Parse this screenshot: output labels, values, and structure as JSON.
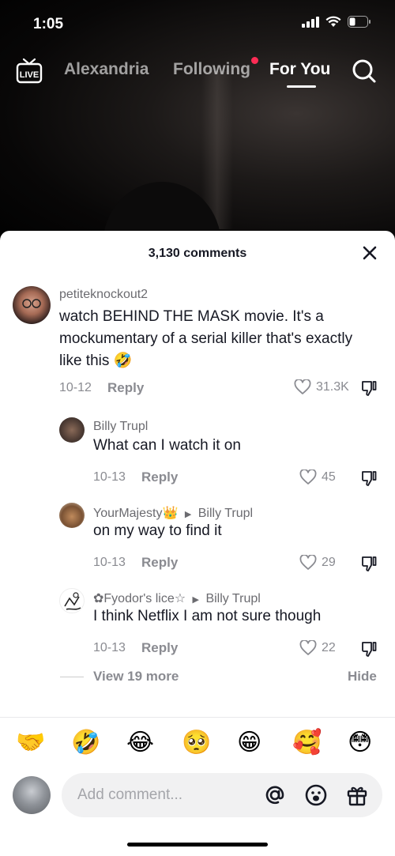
{
  "status_bar": {
    "time": "1:05"
  },
  "top_nav": {
    "live_label": "LIVE",
    "tabs": [
      {
        "label": "Alexandria",
        "active": false
      },
      {
        "label": "Following",
        "active": false,
        "has_dot": true
      },
      {
        "label": "For You",
        "active": true
      }
    ]
  },
  "comments_sheet": {
    "title": "3,130 comments",
    "comments": [
      {
        "username": "petiteknockout2",
        "text": "watch BEHIND THE MASK movie. It's a mockumentary of a serial killer that's exactly like this 🤣",
        "date": "10-12",
        "reply_label": "Reply",
        "likes": "31.3K"
      }
    ],
    "replies": [
      {
        "username": "Billy Trupl",
        "reply_to": "",
        "text": "What can I watch it on",
        "date": "10-13",
        "reply_label": "Reply",
        "likes": "45"
      },
      {
        "username": "YourMajesty👑",
        "reply_to": "Billy Trupl",
        "text": "on my way to find it",
        "date": "10-13",
        "reply_label": "Reply",
        "likes": "29"
      },
      {
        "username": "✿Fyodor's lice☆",
        "reply_to": "Billy Trupl",
        "text": "I think Netflix I am not sure though",
        "date": "10-13",
        "reply_label": "Reply",
        "likes": "22"
      }
    ],
    "view_more": "View 19 more",
    "hide": "Hide"
  },
  "emoji_bar": [
    "🤝",
    "🤣",
    "😂",
    "🥺",
    "😁",
    "🥰",
    "😳"
  ],
  "comment_input": {
    "placeholder": "Add comment..."
  },
  "icons": [
    "live-icon",
    "search-icon",
    "close-icon",
    "heart-icon",
    "dislike-icon",
    "at-icon",
    "emoji-icon",
    "gift-icon"
  ],
  "colors": {
    "accent_dot": "#fe2c55",
    "text_primary": "#161823",
    "text_secondary": "#8a8b91"
  }
}
